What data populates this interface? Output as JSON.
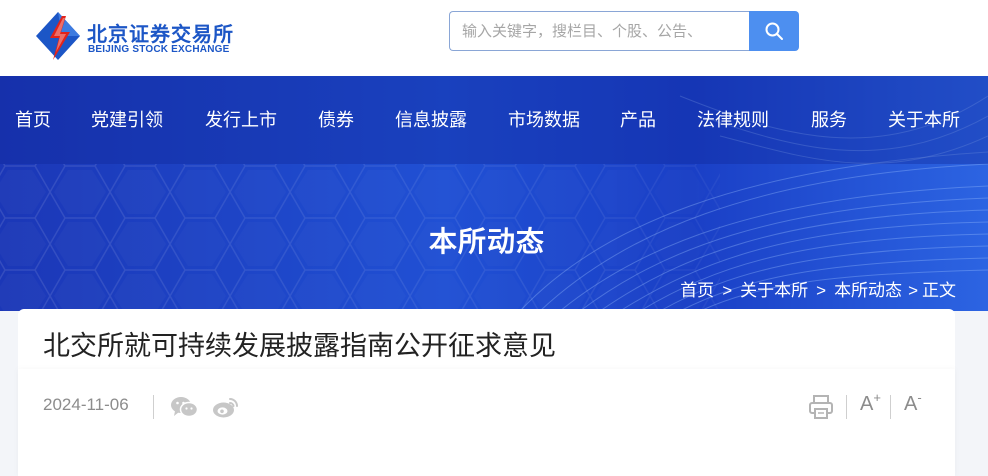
{
  "header": {
    "logo_cn": "北京证券交易所",
    "logo_en": "BEIJING STOCK EXCHANGE",
    "search": {
      "placeholder": "输入关键字，搜栏目、个股、公告、",
      "value": ""
    }
  },
  "nav": {
    "items": [
      {
        "label": "首页"
      },
      {
        "label": "党建引领"
      },
      {
        "label": "发行上市"
      },
      {
        "label": "债券"
      },
      {
        "label": "信息披露"
      },
      {
        "label": "市场数据"
      },
      {
        "label": "产品"
      },
      {
        "label": "法律规则"
      },
      {
        "label": "服务"
      },
      {
        "label": "关于本所"
      }
    ]
  },
  "banner": {
    "title": "本所动态"
  },
  "breadcrumb": {
    "home": "首页",
    "about": "关于本所",
    "news": "本所动态",
    "current": "正文",
    "separator": ">"
  },
  "article": {
    "title": "北交所就可持续发展披露指南公开征求意见",
    "date": "2024-11-06",
    "font_increase": "A",
    "font_increase_mark": "+",
    "font_decrease": "A",
    "font_decrease_mark": "-"
  },
  "icons": {
    "search": "search-icon",
    "wechat": "wechat-icon",
    "weibo": "weibo-icon",
    "print": "print-icon"
  },
  "colors": {
    "brand_blue": "#1c56c6",
    "brand_red": "#e2231a",
    "banner_blue": "#2050d4",
    "search_button": "#4d8ff0",
    "meta_gray": "#8c8c8c"
  }
}
